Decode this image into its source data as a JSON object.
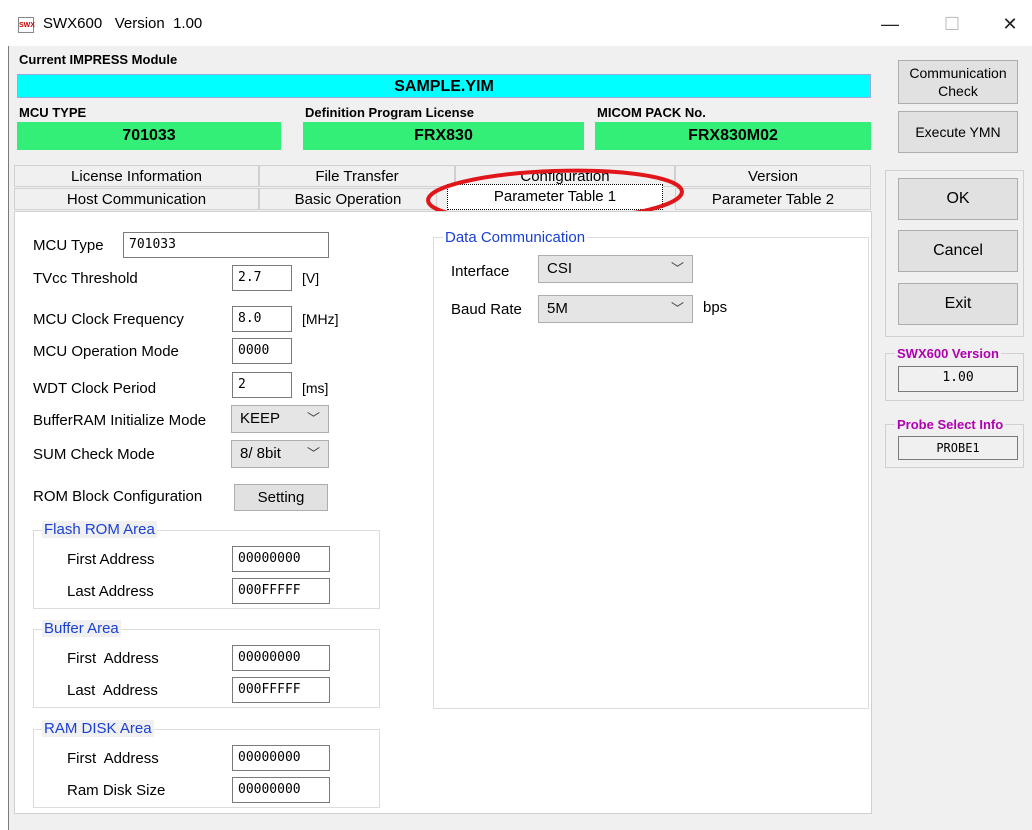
{
  "window": {
    "app_icon_text": "SWX",
    "title": "SWX600   Version  1.00",
    "minimize_glyph": "—",
    "maximize_glyph": "☐",
    "close_glyph": "✕"
  },
  "module": {
    "label": "Current IMPRESS Module",
    "value": "SAMPLE.YIM",
    "mcu_type_label": "MCU TYPE",
    "mcu_type_value": "701033",
    "license_label": "Definition Program License",
    "license_value": "FRX830",
    "micom_label": "MICOM PACK No.",
    "micom_value": "FRX830M02"
  },
  "tabs_row1": [
    "License Information",
    "File Transfer",
    "Configuration",
    "Version"
  ],
  "tabs_row2": [
    "Host Communication",
    "Basic Operation",
    "Parameter Table 1",
    "Parameter Table 2"
  ],
  "params": {
    "mcu_type_label": "MCU Type",
    "mcu_type_value": "701033",
    "tvcc_label": "TVcc Threshold",
    "tvcc_value": "2.7",
    "tvcc_unit": "[V]",
    "clock_label": "MCU Clock Frequency",
    "clock_value": "8.0",
    "clock_unit": "[MHz]",
    "opmode_label": "MCU Operation Mode",
    "opmode_value": "0000",
    "wdt_label": "WDT Clock Period",
    "wdt_value": "2",
    "wdt_unit": "[ms]",
    "bufferram_label": "BufferRAM Initialize Mode",
    "bufferram_value": "KEEP",
    "sum_label": "SUM Check Mode",
    "sum_value": "8/ 8bit",
    "romblock_label": "ROM Block Configuration",
    "romblock_button": "Setting"
  },
  "flash_rom": {
    "title": "Flash ROM Area",
    "first_label": "First Address",
    "first_value": "00000000",
    "last_label": "Last Address",
    "last_value": "000FFFFF"
  },
  "buffer_area": {
    "title": "Buffer Area",
    "first_label": "First  Address",
    "first_value": "00000000",
    "last_label": "Last  Address",
    "last_value": "000FFFFF"
  },
  "ram_disk": {
    "title": "RAM DISK Area",
    "first_label": "First  Address",
    "first_value": "00000000",
    "size_label": "Ram Disk Size",
    "size_value": "00000000"
  },
  "data_comm": {
    "title": "Data Communication",
    "interface_label": "Interface",
    "interface_value": "CSI",
    "baud_label": "Baud Rate",
    "baud_value": "5M",
    "baud_unit": "bps"
  },
  "side": {
    "comm_check": "Communication Check",
    "execute_ymn": "Execute YMN",
    "ok": "OK",
    "cancel": "Cancel",
    "exit": "Exit",
    "version_label": "SWX600 Version",
    "version_value": "1.00",
    "probe_label": "Probe Select Info",
    "probe_value": "PROBE1"
  },
  "colors": {
    "module_bar": "#00ffff",
    "info_bar": "#33ee77",
    "group_title": "#1a3fd4",
    "side_label": "#b000b0",
    "annotation_ellipse": "#e0161b"
  }
}
